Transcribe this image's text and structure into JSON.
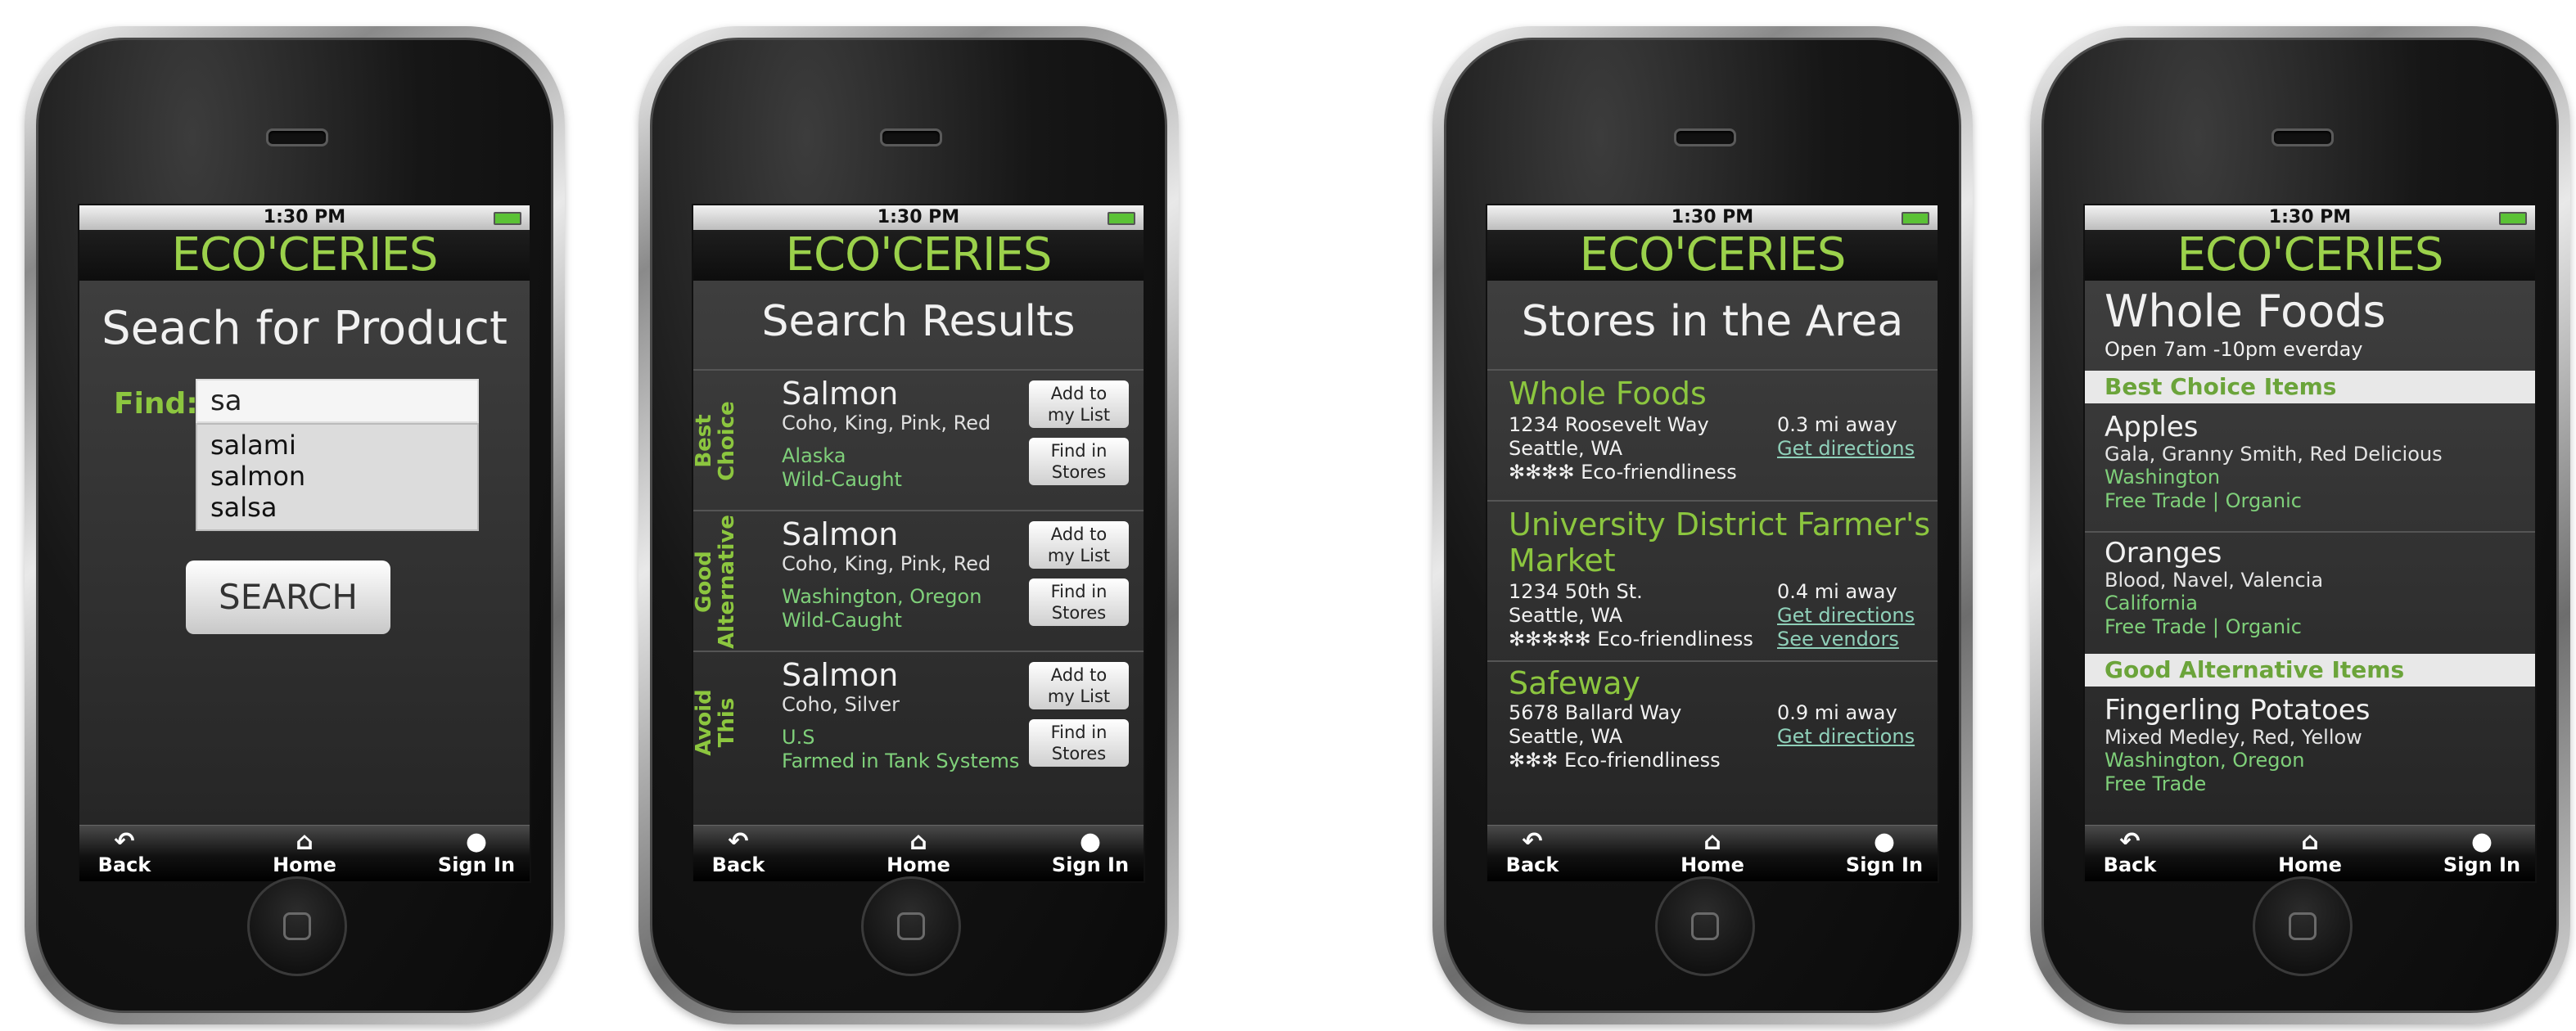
{
  "common": {
    "time": "1:30 PM",
    "logo": "ECO'CERIES",
    "tabs": {
      "back": "Back",
      "home": "Home",
      "signin": "Sign In"
    }
  },
  "search_page": {
    "title": "Seach for Product",
    "find_label": "Find:",
    "input_value": "sa",
    "suggestions": [
      "salami",
      "salmon",
      "salsa"
    ],
    "button": "SEARCH"
  },
  "results_page": {
    "title": "Search Results",
    "sections": [
      {
        "label_line1": "Best",
        "label_line2": "Choice",
        "name": "Salmon",
        "types": "Coho, King, Pink, Red",
        "origin": "Alaska",
        "method": "Wild-Caught",
        "add_btn": [
          "Add to",
          "my List"
        ],
        "find_btn": [
          "Find in",
          "Stores"
        ]
      },
      {
        "label_line1": "Good",
        "label_line2": "Alternative",
        "name": "Salmon",
        "types": "Coho, King, Pink, Red",
        "origin": "Washington, Oregon",
        "method": "Wild-Caught",
        "add_btn": [
          "Add to",
          "my List"
        ],
        "find_btn": [
          "Find in",
          "Stores"
        ]
      },
      {
        "label_line1": "Avoid",
        "label_line2": "This",
        "name": "Salmon",
        "types": "Coho, Silver",
        "origin": "U.S",
        "method": "Farmed in Tank Systems",
        "add_btn": [
          "Add to",
          "my List"
        ],
        "find_btn": [
          "Find in",
          "Stores"
        ]
      }
    ]
  },
  "stores_page": {
    "title": "Stores in the Area",
    "stores": [
      {
        "name": "Whole Foods",
        "address": "1234 Roosevelt Way",
        "city": "Seattle, WA",
        "stars": "✻✻✻✻",
        "eco": "Eco-friendliness",
        "distance": "0.3 mi away",
        "directions": "Get directions"
      },
      {
        "name_line1": "University District Farmer's",
        "name_line2": "Market",
        "address": "1234 50th St.",
        "city": "Seattle, WA",
        "stars": "✻✻✻✻✻",
        "eco": "Eco-friendliness",
        "distance": "0.4 mi away",
        "directions": "Get directions",
        "vendors": "See vendors"
      },
      {
        "name": "Safeway",
        "address": "5678 Ballard Way",
        "city": "Seattle, WA",
        "stars": "✻✻✻",
        "eco": "Eco-friendliness",
        "distance": "0.9 mi away",
        "directions": "Get directions"
      }
    ]
  },
  "store_detail_page": {
    "store_name": "Whole Foods",
    "hours": "Open 7am -10pm everday",
    "best_band": "Best Choice Items",
    "good_band": "Good Alternative Items",
    "items": [
      {
        "name": "Apples",
        "varieties": "Gala, Granny Smith, Red Delicious",
        "origin": "Washington",
        "tags": "Free Trade  |  Organic"
      },
      {
        "name": "Oranges",
        "varieties": "Blood, Navel, Valencia",
        "origin": "California",
        "tags": "Free Trade  |  Organic"
      },
      {
        "name": "Fingerling Potatoes",
        "varieties": "Mixed Medley, Red, Yellow",
        "origin": "Washington, Oregon",
        "tags": "Free Trade"
      }
    ]
  },
  "colors": {
    "accent_green": "#8cc63f",
    "light_green": "#7fd07a",
    "link": "#8fd0b9"
  }
}
